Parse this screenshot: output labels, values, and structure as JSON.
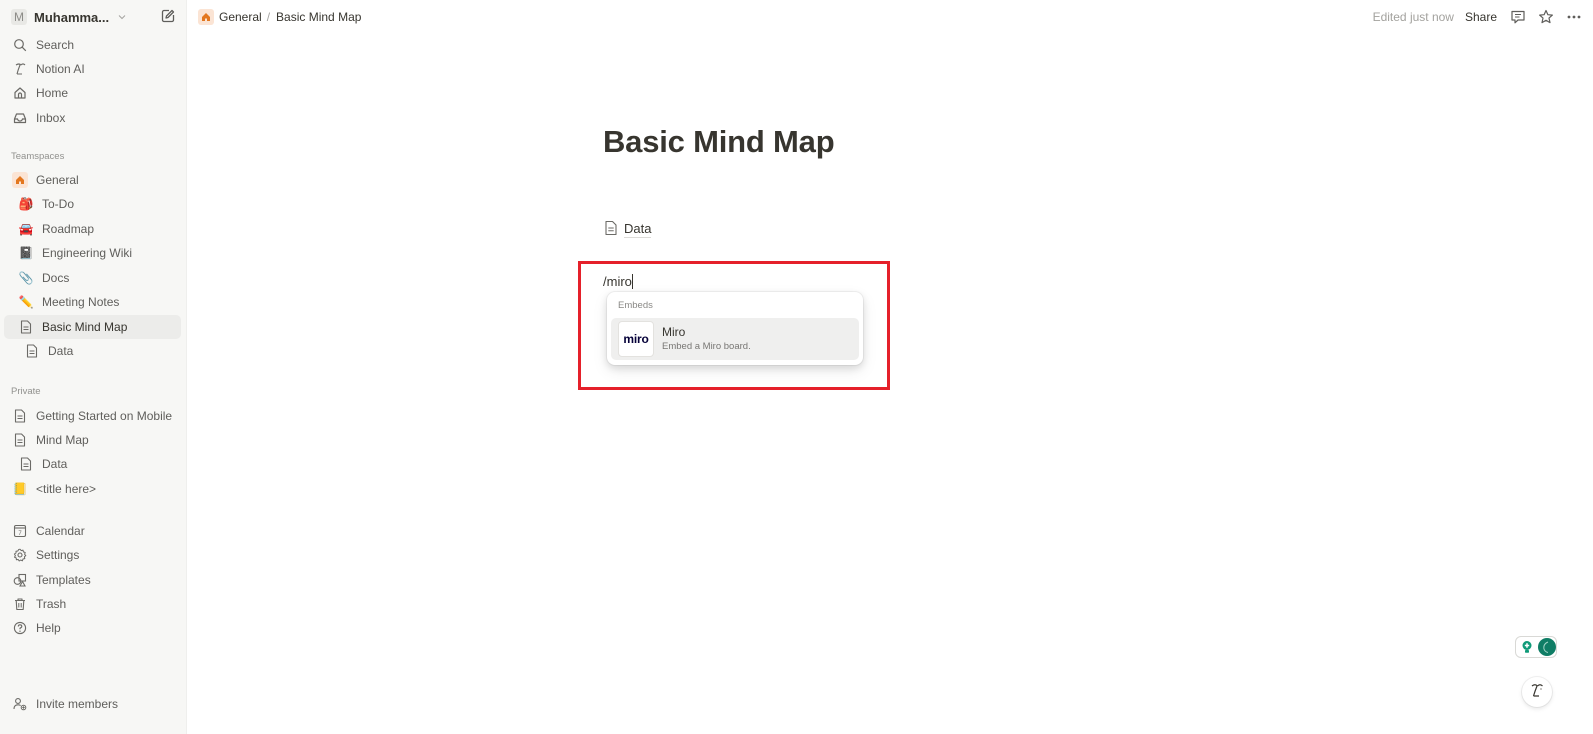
{
  "workspace": {
    "avatar_letter": "M",
    "name": "Muhamma..."
  },
  "sidebar": {
    "top_items": [
      {
        "label": "Search",
        "icon": "search-icon"
      },
      {
        "label": "Notion AI",
        "icon": "notion-ai-icon"
      },
      {
        "label": "Home",
        "icon": "home-icon"
      },
      {
        "label": "Inbox",
        "icon": "inbox-icon"
      }
    ],
    "teamspaces_label": "Teamspaces",
    "teamspace": {
      "label": "General",
      "icon": "home-icon"
    },
    "teamspace_pages": [
      {
        "label": "To-Do",
        "icon": "🎒"
      },
      {
        "label": "Roadmap",
        "icon": "🚘"
      },
      {
        "label": "Engineering Wiki",
        "icon": "📓"
      },
      {
        "label": "Docs",
        "icon": "📎"
      },
      {
        "label": "Meeting Notes",
        "icon": "✏️"
      },
      {
        "label": "Basic Mind Map",
        "icon": "page-icon",
        "active": true
      },
      {
        "label": "Data",
        "icon": "page-icon"
      }
    ],
    "private_label": "Private",
    "private_pages": [
      {
        "label": "Getting Started on Mobile",
        "icon": "page-icon"
      },
      {
        "label": "Mind Map",
        "icon": "page-icon"
      },
      {
        "label": "Data",
        "icon": "page-icon"
      },
      {
        "label": "<title here>",
        "icon": "📒"
      }
    ],
    "bottom_items": [
      {
        "label": "Calendar",
        "icon": "calendar-icon",
        "calendar_day": "7"
      },
      {
        "label": "Settings",
        "icon": "gear-icon"
      },
      {
        "label": "Templates",
        "icon": "templates-icon"
      },
      {
        "label": "Trash",
        "icon": "trash-icon"
      },
      {
        "label": "Help",
        "icon": "help-icon"
      }
    ],
    "invite_label": "Invite members"
  },
  "topbar": {
    "breadcrumb": [
      "General",
      "Basic Mind Map"
    ],
    "breadcrumb_separator": "/",
    "edited_status": "Edited just now",
    "share_label": "Share"
  },
  "page": {
    "title": "Basic Mind Map",
    "subpage_link": "Data",
    "slash_command_text": "/miro"
  },
  "slash_menu": {
    "section_label": "Embeds",
    "items": [
      {
        "logo_text": "miro",
        "title": "Miro",
        "description": "Embed a Miro board."
      }
    ]
  },
  "colors": {
    "highlight_border": "#e5202a",
    "sidebar_bg": "#f7f7f5",
    "helper_accent": "#0f7d65"
  }
}
